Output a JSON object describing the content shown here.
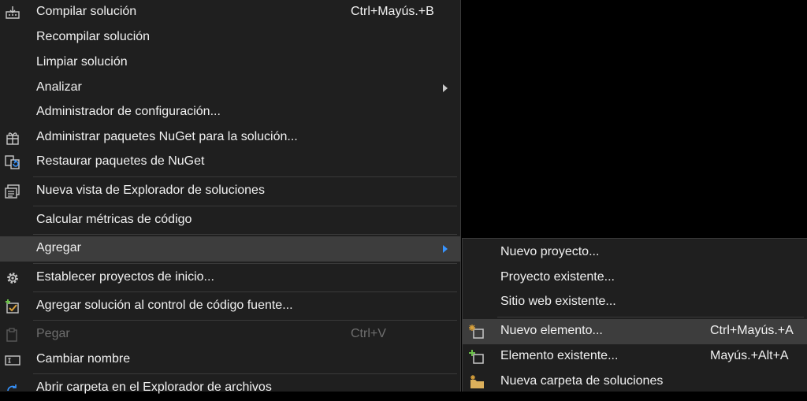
{
  "main_menu": {
    "items": [
      {
        "label": "Compilar solución",
        "shortcut": "Ctrl+Mayús.+B",
        "icon": "build-icon"
      },
      {
        "label": "Recompilar solución"
      },
      {
        "label": "Limpiar solución"
      },
      {
        "label": "Analizar",
        "submenu": true
      },
      {
        "label": "Administrador de configuración..."
      },
      {
        "label": "Administrar paquetes NuGet para la solución...",
        "icon": "nuget-package-icon"
      },
      {
        "label": "Restaurar paquetes de NuGet",
        "icon": "restore-packages-icon"
      },
      {
        "label": "Nueva vista de Explorador de soluciones",
        "icon": "new-solution-explorer-view-icon"
      },
      {
        "label": "Calcular métricas de código"
      },
      {
        "label": "Agregar",
        "submenu": true,
        "highlighted": true
      },
      {
        "label": "Establecer proyectos de inicio...",
        "icon": "gear-icon"
      },
      {
        "label": "Agregar solución al control de código fuente...",
        "icon": "source-control-icon"
      },
      {
        "label": "Pegar",
        "shortcut": "Ctrl+V",
        "disabled": true,
        "icon": "paste-icon"
      },
      {
        "label": "Cambiar nombre",
        "icon": "rename-icon"
      },
      {
        "label": "Abrir carpeta en el Explorador de archivos"
      }
    ]
  },
  "sub_menu": {
    "items": [
      {
        "label": "Nuevo proyecto..."
      },
      {
        "label": "Proyecto existente..."
      },
      {
        "label": "Sitio web existente..."
      },
      {
        "label": "Nuevo elemento...",
        "shortcut": "Ctrl+Mayús.+A",
        "icon": "new-item-icon",
        "highlighted": true
      },
      {
        "label": "Elemento existente...",
        "shortcut": "Mayús.+Alt+A",
        "icon": "existing-item-icon"
      },
      {
        "label": "Nueva carpeta de soluciones",
        "icon": "solution-folder-icon"
      }
    ]
  },
  "colors": {
    "accent": "#3794ff",
    "menu_bg": "#1f1f1f",
    "highlight": "#3d3d3d",
    "nuget_icon": "#d9a13b",
    "folder_icon": "#dcb05b",
    "add_icon": "#6cc04a"
  }
}
